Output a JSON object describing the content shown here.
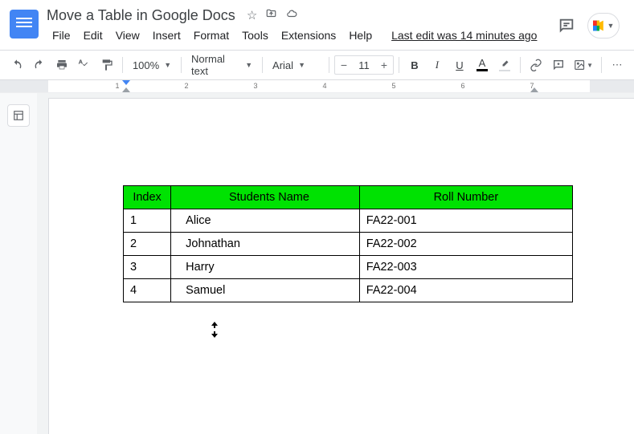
{
  "doc_title": "Move a Table in Google Docs",
  "menu": {
    "file": "File",
    "edit": "Edit",
    "view": "View",
    "insert": "Insert",
    "format": "Format",
    "tools": "Tools",
    "extensions": "Extensions",
    "help": "Help"
  },
  "last_edit": "Last edit was 14 minutes ago",
  "toolbar": {
    "zoom": "100%",
    "style": "Normal text",
    "font": "Arial",
    "font_size": "11",
    "bold": "B",
    "italic": "I",
    "underline": "U",
    "text_color": "A"
  },
  "ruler": {
    "n1": "1",
    "n2": "2",
    "n3": "3",
    "n4": "4",
    "n5": "5",
    "n6": "6",
    "n7": "7"
  },
  "table": {
    "headers": {
      "index": "Index",
      "name": "Students Name",
      "roll": "Roll Number"
    },
    "rows": [
      {
        "index": "1",
        "name": "Alice",
        "roll": "FA22-001"
      },
      {
        "index": "2",
        "name": "Johnathan",
        "roll": "FA22-002"
      },
      {
        "index": "3",
        "name": "Harry",
        "roll": "FA22-003"
      },
      {
        "index": "4",
        "name": "Samuel",
        "roll": "FA22-004"
      }
    ]
  }
}
